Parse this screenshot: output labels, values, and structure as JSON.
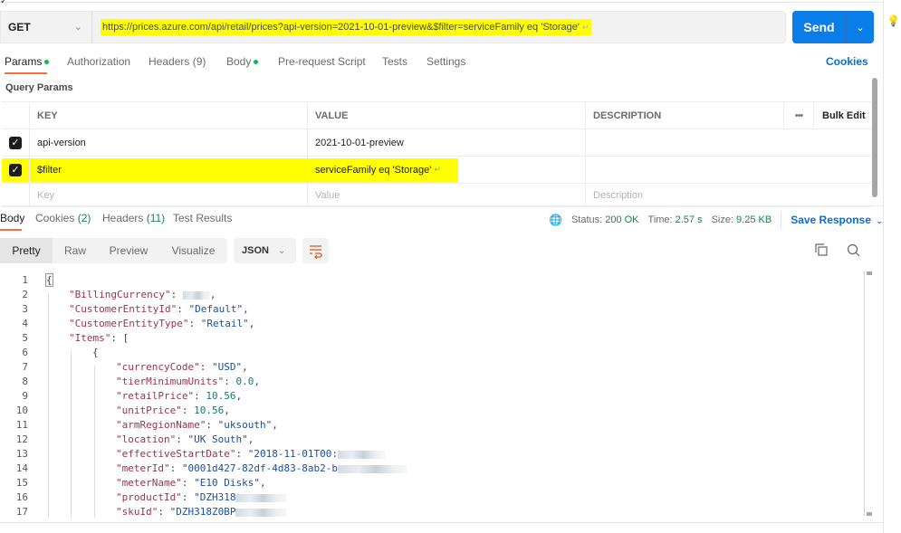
{
  "request": {
    "method": "GET",
    "url": "https://prices.azure.com/api/retail/prices?api-version=2021-10-01-preview&$filter=serviceFamily eq 'Storage'",
    "url_return_glyph": "↵",
    "send_label": "Send"
  },
  "request_tabs": [
    {
      "label": "Params",
      "active": true,
      "dot": true
    },
    {
      "label": "Authorization",
      "active": false
    },
    {
      "label": "Headers (9)",
      "active": false
    },
    {
      "label": "Body",
      "active": false,
      "dot": true
    },
    {
      "label": "Pre-request Script",
      "active": false
    },
    {
      "label": "Tests",
      "active": false
    },
    {
      "label": "Settings",
      "active": false
    }
  ],
  "cookies_link": "Cookies",
  "query_params": {
    "title": "Query Params",
    "headers": {
      "key": "KEY",
      "value": "VALUE",
      "description": "DESCRIPTION",
      "more": "•••",
      "bulk_edit": "Bulk Edit"
    },
    "rows": [
      {
        "checked": true,
        "key": "api-version",
        "value": "2021-10-01-preview",
        "description": ""
      },
      {
        "checked": true,
        "key": "$filter",
        "value": "serviceFamily eq 'Storage'",
        "value_return_glyph": "↵",
        "description": "",
        "highlighted": true
      }
    ],
    "placeholders": {
      "key": "Key",
      "value": "Value",
      "description": "Description"
    }
  },
  "response": {
    "tabs": [
      {
        "label": "Body",
        "active": true
      },
      {
        "label": "Cookies",
        "count": "(2)"
      },
      {
        "label": "Headers",
        "count": "(11)"
      },
      {
        "label": "Test Results"
      }
    ],
    "status_label": "Status:",
    "status_value": "200 OK",
    "time_label": "Time:",
    "time_value": "2.57 s",
    "size_label": "Size:",
    "size_value": "9.25 KB",
    "save_response": "Save Response",
    "view_modes": [
      "Pretty",
      "Raw",
      "Preview",
      "Visualize"
    ],
    "active_view": "Pretty",
    "format": "JSON",
    "code_lines": [
      {
        "n": "1",
        "indent": 0,
        "parts": [
          {
            "t": "{",
            "c": "brace"
          }
        ]
      },
      {
        "n": "2",
        "indent": 1,
        "parts": [
          {
            "t": "\"BillingCurrency\"",
            "c": "k"
          },
          {
            "t": ": ",
            "c": "p"
          },
          {
            "t": "",
            "c": "blur",
            "w": 30
          },
          {
            "t": ",",
            "c": "p"
          }
        ]
      },
      {
        "n": "3",
        "indent": 1,
        "parts": [
          {
            "t": "\"CustomerEntityId\"",
            "c": "k"
          },
          {
            "t": ": ",
            "c": "p"
          },
          {
            "t": "\"Default\"",
            "c": "s"
          },
          {
            "t": ",",
            "c": "p"
          }
        ]
      },
      {
        "n": "4",
        "indent": 1,
        "parts": [
          {
            "t": "\"CustomerEntityType\"",
            "c": "k"
          },
          {
            "t": ": ",
            "c": "p"
          },
          {
            "t": "\"Retail\"",
            "c": "s"
          },
          {
            "t": ",",
            "c": "p"
          }
        ]
      },
      {
        "n": "5",
        "indent": 1,
        "parts": [
          {
            "t": "\"Items\"",
            "c": "k"
          },
          {
            "t": ": [",
            "c": "p"
          }
        ]
      },
      {
        "n": "6",
        "indent": 2,
        "parts": [
          {
            "t": "{",
            "c": "p"
          }
        ]
      },
      {
        "n": "7",
        "indent": 3,
        "parts": [
          {
            "t": "\"currencyCode\"",
            "c": "k"
          },
          {
            "t": ": ",
            "c": "p"
          },
          {
            "t": "\"USD\"",
            "c": "s"
          },
          {
            "t": ",",
            "c": "p"
          }
        ]
      },
      {
        "n": "8",
        "indent": 3,
        "parts": [
          {
            "t": "\"tierMinimumUnits\"",
            "c": "k"
          },
          {
            "t": ": ",
            "c": "p"
          },
          {
            "t": "0.0",
            "c": "n"
          },
          {
            "t": ",",
            "c": "p"
          }
        ]
      },
      {
        "n": "9",
        "indent": 3,
        "parts": [
          {
            "t": "\"retailPrice\"",
            "c": "k"
          },
          {
            "t": ": ",
            "c": "p"
          },
          {
            "t": "10.56",
            "c": "n"
          },
          {
            "t": ",",
            "c": "p"
          }
        ]
      },
      {
        "n": "10",
        "indent": 3,
        "parts": [
          {
            "t": "\"unitPrice\"",
            "c": "k"
          },
          {
            "t": ": ",
            "c": "p"
          },
          {
            "t": "10.56",
            "c": "n"
          },
          {
            "t": ",",
            "c": "p"
          }
        ]
      },
      {
        "n": "11",
        "indent": 3,
        "parts": [
          {
            "t": "\"armRegionName\"",
            "c": "k"
          },
          {
            "t": ": ",
            "c": "p"
          },
          {
            "t": "\"uksouth\"",
            "c": "s"
          },
          {
            "t": ",",
            "c": "p"
          }
        ]
      },
      {
        "n": "12",
        "indent": 3,
        "parts": [
          {
            "t": "\"location\"",
            "c": "k"
          },
          {
            "t": ": ",
            "c": "p"
          },
          {
            "t": "\"UK South\"",
            "c": "s"
          },
          {
            "t": ",",
            "c": "p"
          }
        ]
      },
      {
        "n": "13",
        "indent": 3,
        "parts": [
          {
            "t": "\"effectiveStartDate\"",
            "c": "k"
          },
          {
            "t": ": ",
            "c": "p"
          },
          {
            "t": "\"2018-11-01T00:",
            "c": "s"
          },
          {
            "t": "",
            "c": "blur",
            "w": 52
          }
        ]
      },
      {
        "n": "14",
        "indent": 3,
        "parts": [
          {
            "t": "\"meterId\"",
            "c": "k"
          },
          {
            "t": ": ",
            "c": "p"
          },
          {
            "t": "\"0001d427-82df-4d83-8ab2-b",
            "c": "s"
          },
          {
            "t": "",
            "c": "blur",
            "w": 76
          }
        ]
      },
      {
        "n": "15",
        "indent": 3,
        "parts": [
          {
            "t": "\"meterName\"",
            "c": "k"
          },
          {
            "t": ": ",
            "c": "p"
          },
          {
            "t": "\"E10 Disks\"",
            "c": "s"
          },
          {
            "t": ",",
            "c": "p"
          }
        ]
      },
      {
        "n": "16",
        "indent": 3,
        "parts": [
          {
            "t": "\"productId\"",
            "c": "k"
          },
          {
            "t": ": ",
            "c": "p"
          },
          {
            "t": "\"DZH318",
            "c": "s"
          },
          {
            "t": "",
            "c": "blur",
            "w": 56
          }
        ]
      },
      {
        "n": "17",
        "indent": 3,
        "parts": [
          {
            "t": "\"skuId\"",
            "c": "k"
          },
          {
            "t": ": ",
            "c": "p"
          },
          {
            "t": "\"DZH318Z0BP",
            "c": "s"
          },
          {
            "t": "",
            "c": "blur",
            "w": 56
          }
        ]
      }
    ]
  }
}
